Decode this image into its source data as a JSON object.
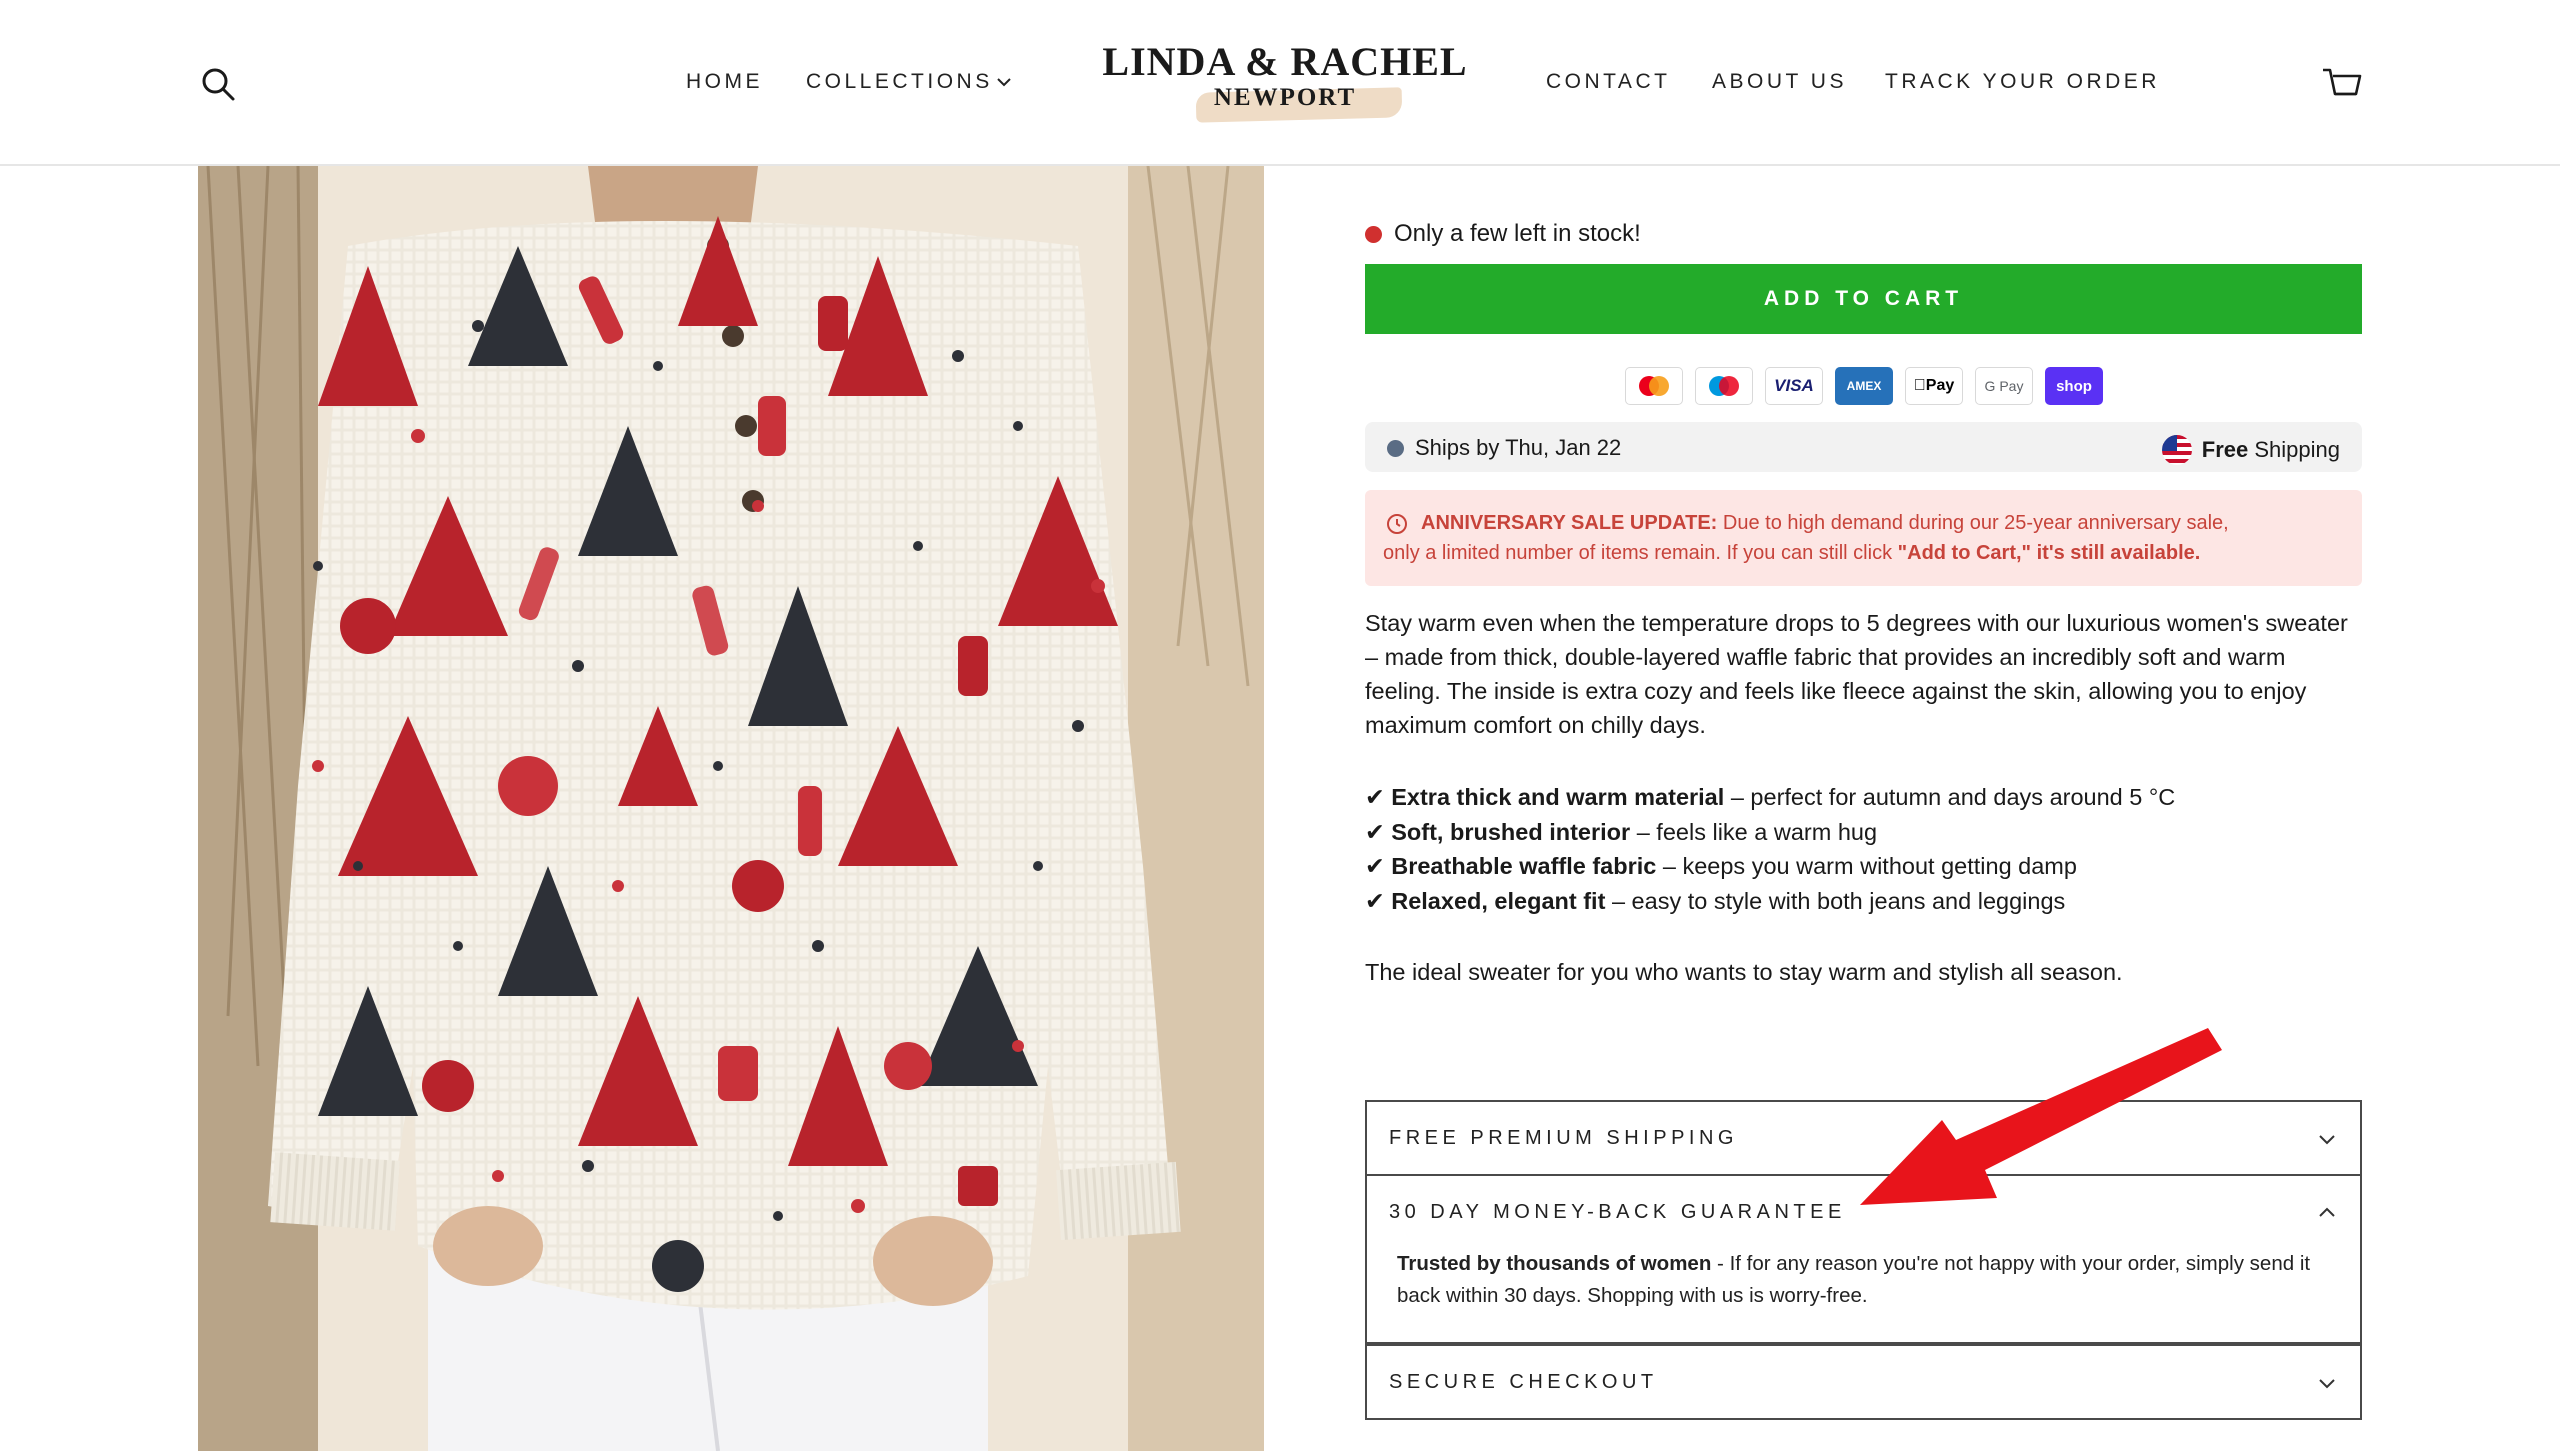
{
  "header": {
    "nav_left": [
      "HOME",
      "COLLECTIONS"
    ],
    "nav_right": [
      "CONTACT",
      "ABOUT US",
      "TRACK YOUR ORDER"
    ],
    "logo": {
      "line1": "LINDA & RACHEL",
      "line2": "NEWPORT"
    },
    "icons": {
      "search": "search-icon",
      "cart": "cart-icon",
      "collections_dropdown": "chevron-down-icon"
    }
  },
  "product": {
    "image_alt": "Christmas print waffle knit sweater"
  },
  "stock": {
    "text": "Only a few left in stock!",
    "dot_color": "#d0302f"
  },
  "add_to_cart": {
    "label": "ADD TO CART",
    "color": "#23ab2a"
  },
  "payments": [
    {
      "name": "mastercard-icon",
      "label": ""
    },
    {
      "name": "maestro-icon",
      "label": ""
    },
    {
      "name": "visa-icon",
      "label": "VISA"
    },
    {
      "name": "amex-icon",
      "label": "AMEX"
    },
    {
      "name": "apple-pay-icon",
      "label": "Pay"
    },
    {
      "name": "google-pay-icon",
      "label": "G Pay"
    },
    {
      "name": "shop-pay-icon",
      "label": "shop"
    }
  ],
  "shipping": {
    "ships_by": "Ships by Thu, Jan 22",
    "free_bold": "Free",
    "free_rest": " Shipping"
  },
  "sale": {
    "title": "ANNIVERSARY SALE UPDATE:",
    "text1": " Due to high demand during our 25-year anniversary sale,",
    "text2": "only a limited number of items remain. If you can still click ",
    "text2_bold": "\"Add to Cart,\" it's still available."
  },
  "description": "Stay warm even when the temperature drops to 5 degrees with our luxurious women's sweater – made from thick, double-layered waffle fabric that provides an incredibly soft and warm feeling. The inside is extra cozy and feels like fleece against the skin, allowing you to enjoy maximum comfort on chilly days.",
  "features": [
    {
      "check": "✔",
      "bold": "Extra thick and warm material",
      "rest": " – perfect for autumn and days around 5 °C"
    },
    {
      "check": "✔",
      "bold": "Soft, brushed interior",
      "rest": " – feels like a warm hug"
    },
    {
      "check": "✔",
      "bold": "Breathable waffle fabric",
      "rest": " – keeps you warm without getting damp"
    },
    {
      "check": "✔",
      "bold": "Relaxed, elegant fit",
      "rest": " – easy to style with both jeans and leggings"
    }
  ],
  "closing": "The ideal sweater for you who wants to stay warm and stylish all season.",
  "accordion": [
    {
      "title": "FREE PREMIUM SHIPPING",
      "open": false
    },
    {
      "title": "30 DAY MONEY-BACK GUARANTEE",
      "open": true,
      "body_bold": "Trusted by thousands of women",
      "body_rest": " - If for any reason you're not happy with your order, simply send it back within 30 days. Shopping with us is worry-free."
    },
    {
      "title": "SECURE CHECKOUT",
      "open": false
    }
  ],
  "annotation": {
    "arrow_color": "#e8141b"
  }
}
